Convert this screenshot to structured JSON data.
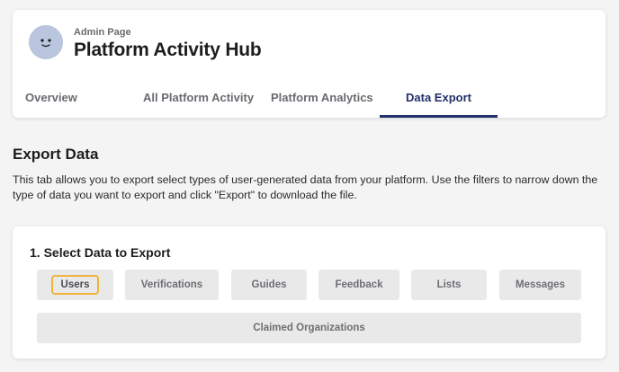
{
  "header": {
    "admin_label": "Admin Page",
    "title": "Platform Activity Hub",
    "avatar_icon": "smiley-avatar-icon"
  },
  "tabs": [
    {
      "label": "Overview",
      "active": false
    },
    {
      "label": "All Platform Activity",
      "active": false
    },
    {
      "label": "Platform Analytics",
      "active": false
    },
    {
      "label": "Data Export",
      "active": true
    }
  ],
  "export": {
    "title": "Export Data",
    "description": "This tab allows you to export select types of user-generated data from your platform. Use the filters to narrow down the type of data you want to export and click \"Export\" to download the file.",
    "select_title": "1. Select Data to Export",
    "options": [
      {
        "label": "Users",
        "selected": true
      },
      {
        "label": "Verifications",
        "selected": false
      },
      {
        "label": "Guides",
        "selected": false
      },
      {
        "label": "Feedback",
        "selected": false
      },
      {
        "label": "Lists",
        "selected": false
      },
      {
        "label": "Messages",
        "selected": false
      },
      {
        "label": "Claimed Organizations",
        "selected": false
      }
    ]
  },
  "colors": {
    "accent": "#22306b",
    "selected_outline": "#f0b33b",
    "chip_bg": "#e9e9ea",
    "page_bg": "#f4f4f5"
  }
}
